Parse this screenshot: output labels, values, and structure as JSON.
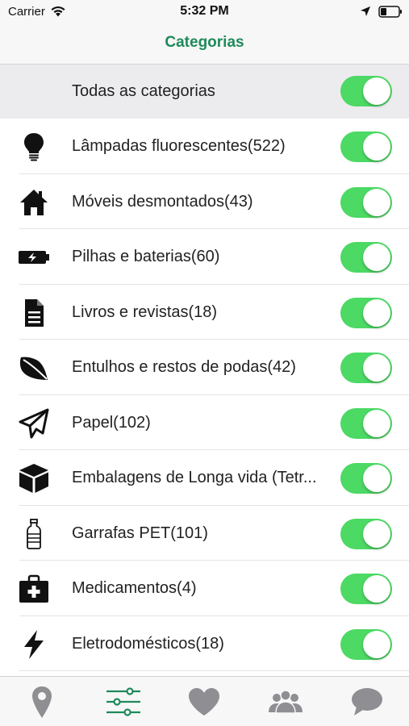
{
  "status_bar": {
    "carrier": "Carrier",
    "time": "5:32 PM"
  },
  "nav": {
    "title": "Categorias"
  },
  "all_categories": {
    "label": "Todas as categorias",
    "enabled": true
  },
  "categories": [
    {
      "label": "Lâmpadas fluorescentes(522)",
      "icon": "lightbulb-icon",
      "enabled": true
    },
    {
      "label": "Móveis desmontados(43)",
      "icon": "house-icon",
      "enabled": true
    },
    {
      "label": "Pilhas e baterias(60)",
      "icon": "battery-icon",
      "enabled": true
    },
    {
      "label": "Livros e revistas(18)",
      "icon": "document-icon",
      "enabled": true
    },
    {
      "label": "Entulhos e restos de podas(42)",
      "icon": "leaf-icon",
      "enabled": true
    },
    {
      "label": "Papel(102)",
      "icon": "paper-plane-icon",
      "enabled": true
    },
    {
      "label": "Embalagens de Longa vida (Tetr...",
      "icon": "box-icon",
      "enabled": true
    },
    {
      "label": "Garrafas PET(101)",
      "icon": "bottle-icon",
      "enabled": true
    },
    {
      "label": "Medicamentos(4)",
      "icon": "medkit-icon",
      "enabled": true
    },
    {
      "label": "Eletrodomésticos(18)",
      "icon": "lightning-icon",
      "enabled": true
    }
  ],
  "tab_bar": {
    "tabs": [
      {
        "icon": "map-pin-icon",
        "active": false
      },
      {
        "icon": "sliders-icon",
        "active": true
      },
      {
        "icon": "heart-icon",
        "active": false
      },
      {
        "icon": "users-icon",
        "active": false
      },
      {
        "icon": "chat-bubble-icon",
        "active": false
      }
    ]
  },
  "colors": {
    "accent": "#1e8a5a",
    "toggle_on": "#4cd964",
    "tab_inactive": "#8e8e93"
  }
}
